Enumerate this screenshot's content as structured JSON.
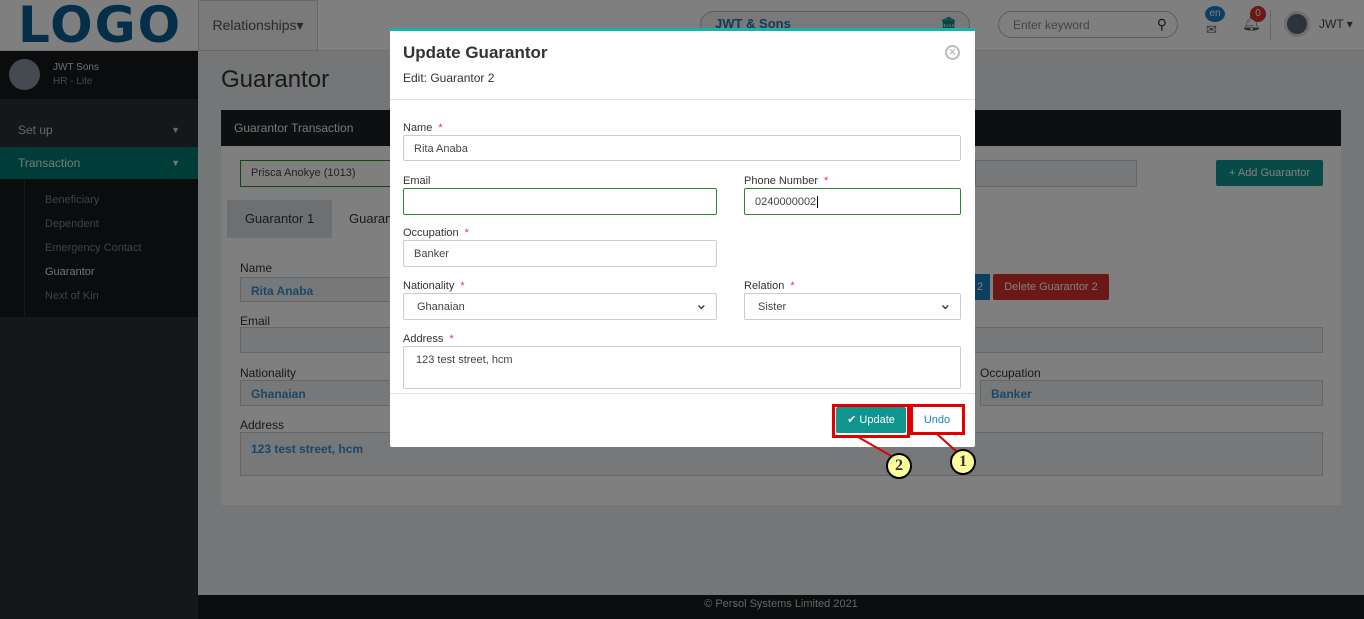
{
  "header": {
    "logo": "LOGO",
    "relationships": "Relationships▾",
    "company": "JWT & Sons",
    "search_placeholder": "Enter keyword",
    "lang_badge": "en",
    "notif_count": "0",
    "user": "JWT ▾"
  },
  "sidebar": {
    "profile_name": "JWT Sons",
    "profile_role": "HR - Lite",
    "menu": [
      {
        "label": "Set up"
      },
      {
        "label": "Transaction"
      }
    ],
    "sub": [
      "Beneficiary",
      "Dependent",
      "Emergency Contact",
      "Guarantor",
      "Next of Kin"
    ]
  },
  "main": {
    "title": "Guarantor",
    "panel_title": "Guarantor Transaction",
    "employee": "Prisca Anokye (1013)",
    "add_button": "+ Add Guarantor",
    "tabs": [
      "Guarantor 1",
      "Guarantor 2"
    ],
    "edit_button": "2",
    "delete_button": "Delete Guarantor 2",
    "fields": {
      "name_label": "Name",
      "name": "Rita Anaba",
      "email_label": "Email",
      "nationality_label": "Nationality",
      "nationality": "Ghanaian",
      "occupation_label": "Occupation",
      "occupation": "Banker",
      "address_label": "Address",
      "address": "123 test street, hcm"
    }
  },
  "modal": {
    "title": "Update Guarantor",
    "subtitle": "Edit: Guarantor 2",
    "name_label": "Name",
    "name": "Rita Anaba",
    "email_label": "Email",
    "email": "",
    "phone_label": "Phone Number",
    "phone": "0240000002",
    "occupation_label": "Occupation",
    "occupation": "Banker",
    "nationality_label": "Nationality",
    "nationality": "Ghanaian",
    "relation_label": "Relation",
    "relation": "Sister",
    "address_label": "Address",
    "address": "123 test street, hcm",
    "update_button": "✔ Update",
    "undo_button": "Undo",
    "required_mark": "*"
  },
  "annotations": {
    "callout_1": "1",
    "callout_2": "2",
    "highlight_color": "#e00000"
  },
  "footer": {
    "text": "© Persol Systems Limited 2021"
  }
}
